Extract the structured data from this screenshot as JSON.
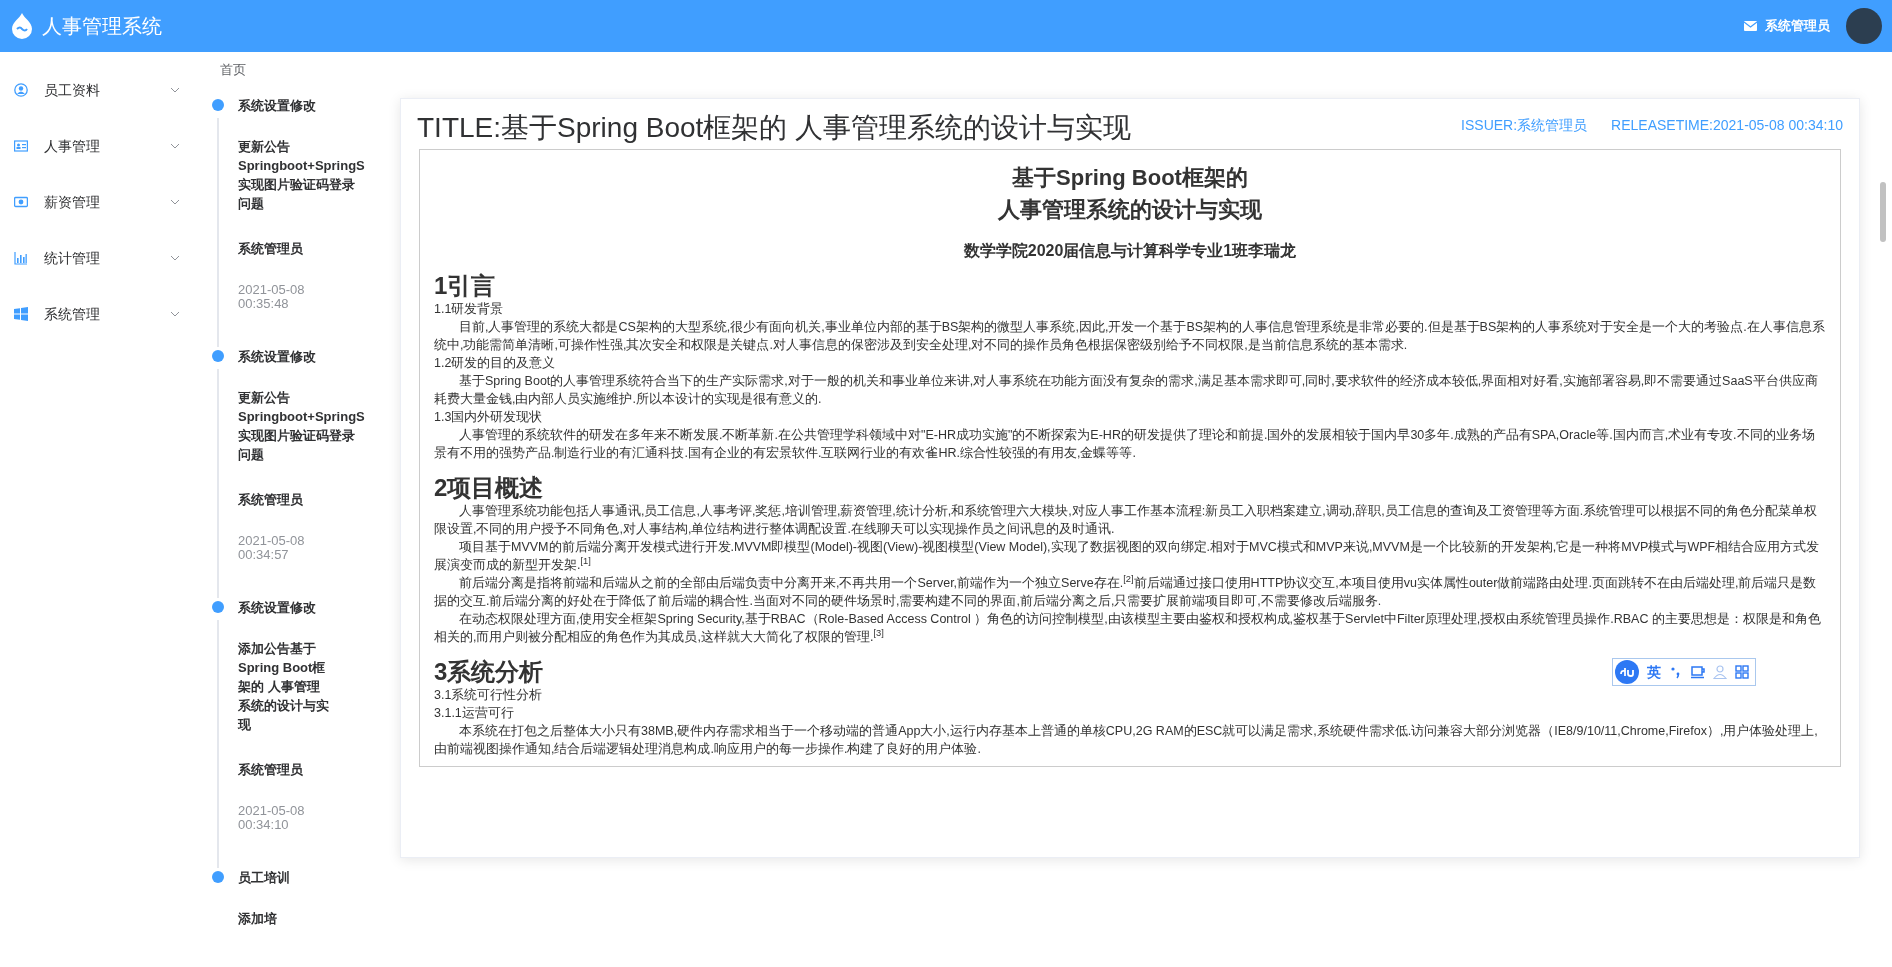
{
  "header": {
    "app_title": "人事管理系统",
    "user": "系统管理员"
  },
  "sidebar": {
    "items": [
      {
        "label": "员工资料",
        "kind": "user",
        "expanded": false
      },
      {
        "label": "人事管理",
        "kind": "card",
        "expanded": false
      },
      {
        "label": "薪资管理",
        "kind": "money",
        "expanded": false
      },
      {
        "label": "统计管理",
        "kind": "chart",
        "expanded": false
      },
      {
        "label": "系统管理",
        "kind": "windows",
        "expanded": false
      }
    ]
  },
  "breadcrumb": [
    "首页"
  ],
  "timeline": [
    {
      "title": "系统设置修改",
      "content": "更新公告Springboot+SpringS实现图片验证码登录问题",
      "author": "系统管理员",
      "time": "2021-05-08 00:35:48"
    },
    {
      "title": "系统设置修改",
      "content": "更新公告Springboot+SpringS实现图片验证码登录问题",
      "author": "系统管理员",
      "time": "2021-05-08 00:34:57"
    },
    {
      "title": "系统设置修改",
      "content": "添加公告基于 Spring Boot框架的 人事管理系统的设计与实现",
      "author": "系统管理员",
      "time": "2021-05-08 00:34:10"
    },
    {
      "title": "员工培训",
      "content": "添加培"
    }
  ],
  "notice": {
    "title": "TITLE:基于Spring Boot框架的 人事管理系统的设计与实现",
    "issuer": "ISSUER:系统管理员",
    "release_time": "RELEASETIME:2021-05-08 00:34:10",
    "document": {
      "title_lines": [
        "基于Spring Boot框架的",
        "人事管理系统的设计与实现"
      ],
      "author_line": "数学学院2020届信息与计算科学专业1班李瑞龙",
      "blocks": [
        {
          "kind": "heading",
          "text": "1引言"
        },
        {
          "kind": "subheading",
          "text": "1.1研发背景"
        },
        {
          "kind": "paragraph",
          "text": "目前,人事管理的系统大都是CS架构的大型系统,很少有面向机关,事业单位内部的基于BS架构的微型人事系统,因此,开发一个基于BS架构的人事信息管理系统是非常必要的.但是基于BS架构的人事系统对于安全是一个大的考验点.在人事信息系统中,功能需简单清晰,可操作性强,其次安全和权限是关键点.对人事信息的保密涉及到安全处理,对不同的操作员角色根据保密级别给予不同权限,是当前信息系统的基本需求."
        },
        {
          "kind": "subheading",
          "text": "1.2研发的目的及意义"
        },
        {
          "kind": "paragraph",
          "text": "基于Spring Boot的人事管理系统符合当下的生产实际需求,对于一般的机关和事业单位来讲,对人事系统在功能方面没有复杂的需求,满足基本需求即可,同时,要求软件的经济成本较低,界面相对好看,实施部署容易,即不需要通过SaaS平台供应商耗费大量金钱,由内部人员实施维护.所以本设计的实现是很有意义的."
        },
        {
          "kind": "subheading",
          "text": "1.3国内外研发现状"
        },
        {
          "kind": "paragraph",
          "text": "人事管理的系统软件的研发在多年来不断发展.不断革新.在公共管理学科领域中对\"E-HR成功实施\"的不断探索为E-HR的研发提供了理论和前提.国外的发展相较于国内早30多年.成熟的产品有SPA,Oracle等.国内而言,术业有专攻.不同的业务场景有不用的强势产品.制造行业的有汇通科技.国有企业的有宏景软件.互联网行业的有欢雀HR.综合性较强的有用友,金蝶等等."
        },
        {
          "kind": "heading",
          "text": "2项目概述"
        },
        {
          "kind": "paragraph",
          "text": "人事管理系统功能包括人事通讯,员工信息,人事考评,奖惩,培训管理,薪资管理,统计分析,和系统管理六大模块,对应人事工作基本流程:新员工入职档案建立,调动,辞职,员工信息的查询及工资管理等方面.系统管理可以根据不同的角色分配菜单权限设置,不同的用户授予不同角色,对人事结构,单位结构进行整体调配设置.在线聊天可以实现操作员之间讯息的及时通讯."
        },
        {
          "kind": "paragraph",
          "text": "项目基于MVVM的前后端分离开发模式进行开发.MVVM即模型(Model)-视图(View)-视图模型(View Model),实现了数据视图的双向绑定.相对于MVC模式和MVP来说,MVVM是一个比较新的开发架构,它是一种将MVP模式与WPF相结合应用方式发展演变而成的新型开发架.$^{[1]}$"
        },
        {
          "kind": "paragraph",
          "text": "前后端分离是指将前端和后端从之前的全部由后端负责中分离开来,不再共用一个Server,前端作为一个独立Serve存在.$^{[2]}$前后端通过接口使用HTTP协议交互,本项目使用vu实体属性outer做前端路由处理.页面跳转不在由后端处理,前后端只是数据的交互.前后端分离的好处在于降低了前后端的耦合性.当面对不同的硬件场景时,需要构建不同的界面,前后端分离之后,只需要扩展前端项目即可,不需要修改后端服务."
        },
        {
          "kind": "paragraph",
          "text": "在动态权限处理方面,使用安全框架Spring Security,基于RBAC（Role-Based Access Control ）角色的访问控制模型,由该模型主要由鉴权和授权构成,鉴权基于Servlet中Filter原理处理,授权由系统管理员操作.RBAC 的主要思想是：权限是和角色相关的,而用户则被分配相应的角色作为其成员,这样就大大简化了权限的管理.$^{[3]}$"
        },
        {
          "kind": "heading",
          "text": "3系统分析"
        },
        {
          "kind": "subheading",
          "text": "3.1系统可行性分析"
        },
        {
          "kind": "subheading",
          "text": "3.1.1运营可行"
        },
        {
          "kind": "paragraph",
          "text": "本系统在打包之后整体大小只有38MB,硬件内存需求相当于一个移动端的普通App大小,运行内存基本上普通的单核CPU,2G RAM的ESC就可以满足需求,系统硬件需求低.访问兼容大部分浏览器（IE8/9/10/11,Chrome,Firefox）,用户体验处理上,由前端视图操作通知,结合后端逻辑处理消息构成.响应用户的每一步操作.构建了良好的用户体验."
        }
      ]
    }
  },
  "ime_toolbar": {
    "language": "英"
  }
}
